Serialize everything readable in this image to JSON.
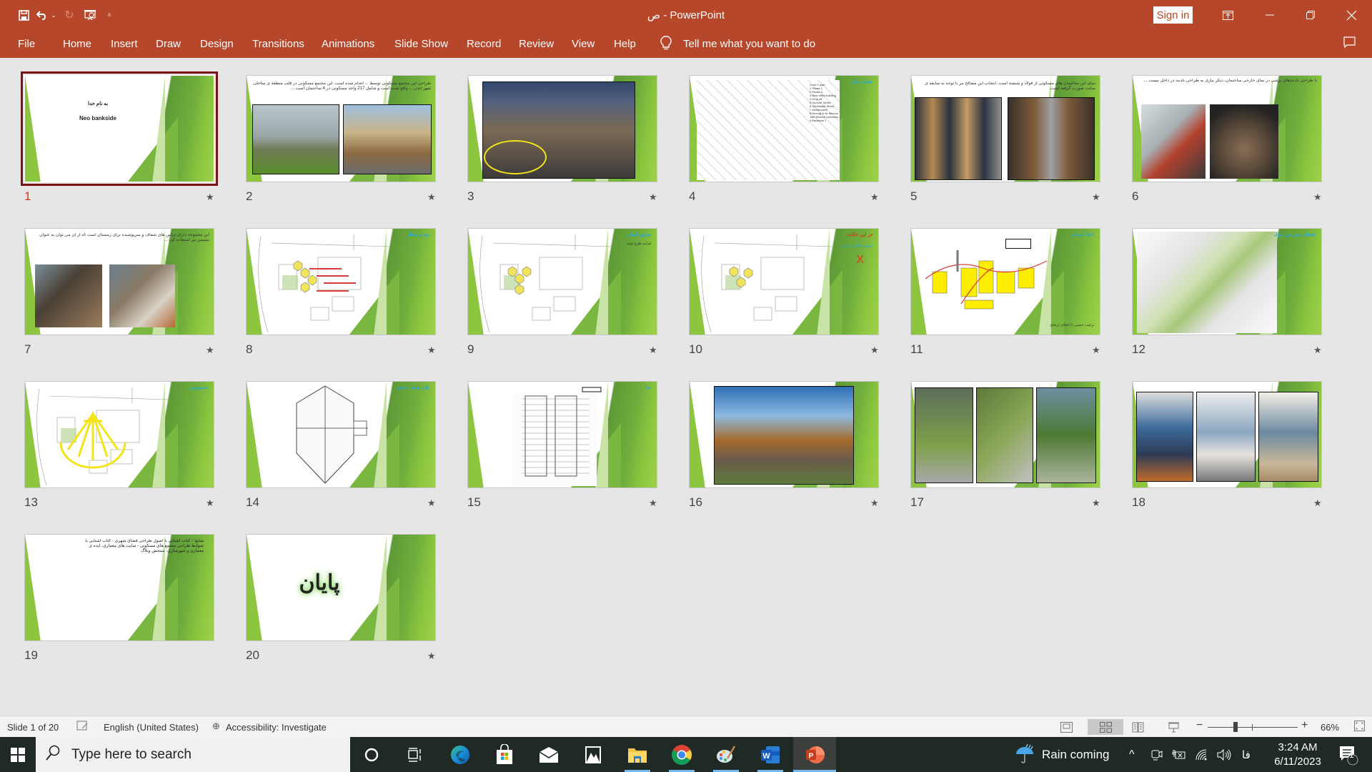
{
  "window": {
    "title": "ص  -  PowerPoint",
    "sign_in": "Sign in"
  },
  "quick_access": [
    "save-icon",
    "undo-icon",
    "undo-dropdown",
    "redo-icon",
    "present-from-start-icon",
    "customize-qat-icon"
  ],
  "menu": {
    "items": [
      "File",
      "Home",
      "Insert",
      "Draw",
      "Design",
      "Transitions",
      "Animations",
      "Slide Show",
      "Record",
      "Review",
      "View",
      "Help"
    ],
    "tell_me": "Tell me what you want to do"
  },
  "slides": [
    {
      "number": "1",
      "selected": true,
      "has_transition": true,
      "title": "به نام خدا",
      "subtitle": "Neo bankside"
    },
    {
      "number": "2",
      "selected": false,
      "has_transition": true,
      "text": "طراحی این مجتمع مسکونی توسط ... انجام شده است. این مجتمع مسکونی در قلب منطقه ی ساحلی شهر لندن ... واقع شده است و شامل 217 واحد مسکونی در 4 ساختمان است ..."
    },
    {
      "number": "3",
      "selected": false,
      "has_transition": true
    },
    {
      "number": "4",
      "selected": false,
      "has_transition": true,
      "label": "سایت پلان",
      "legend": [
        "Level 1 plan",
        "1 Phase 1",
        "2 Phase 2",
        "3 New office building",
        "4 Drop off",
        "5 Sumner Street",
        "6 Southwark Street",
        "7 Almshouses",
        "8 Herzog & de Meuron Tate Modern extension",
        "9 Bankside 1"
      ]
    },
    {
      "number": "5",
      "selected": false,
      "has_transition": true,
      "text": "نمای این ساختمان های مسکونی از فولاد و شیشه است. انتخاب این مصالح نیز با توجه به سابقه ی سایت صورت گرفته است."
    },
    {
      "number": "6",
      "selected": false,
      "has_transition": true,
      "text": "با طراحی بادبندهای برشی در نمای خارجی ساختمان، دیگر نیازی به طراحی بادبند در داخل نیست ..."
    },
    {
      "number": "7",
      "selected": false,
      "has_transition": true,
      "text": "این مجموعه دارای تراس های شفاف و سرپوشیده برای زمستان است که از آن می توان به عنوان نشیمن نیز استفاده کرد ..."
    },
    {
      "number": "8",
      "selected": false,
      "has_transition": true,
      "label": "دید و منظر"
    },
    {
      "number": "9",
      "selected": false,
      "has_transition": true,
      "label": "محور اصلی",
      "sublabel": "فرایند طرح اولیه"
    },
    {
      "number": "10",
      "selected": false,
      "has_transition": true,
      "label": "در این حالت",
      "sublabel": "ستون های مرکزی"
    },
    {
      "number": "11",
      "selected": false,
      "has_transition": true,
      "label": "خط آسمان",
      "sublabel": "ترکیب حجمی با اختلاف ارتفاع"
    },
    {
      "number": "12",
      "selected": false,
      "has_transition": true,
      "label": "فضای سبز بین بلوک"
    },
    {
      "number": "13",
      "selected": false,
      "has_transition": true,
      "label": "دسترسی"
    },
    {
      "number": "14",
      "selected": false,
      "has_transition": true,
      "label": "پلان طبقات تیپ"
    },
    {
      "number": "15",
      "selected": false,
      "has_transition": true,
      "label": "نما"
    },
    {
      "number": "16",
      "selected": false,
      "has_transition": true
    },
    {
      "number": "17",
      "selected": false,
      "has_transition": true
    },
    {
      "number": "18",
      "selected": false,
      "has_transition": true
    },
    {
      "number": "19",
      "selected": false,
      "has_transition": false,
      "text": "منابع: - کتاب آشنایی با اصول طراحی فضای شهری - کتاب آشنایی با ضوابط طراحی مجتمع های مسکونی - سایت های معماری، ایده ی معماری و شهرسازی، سنجش وبلاگ"
    },
    {
      "number": "20",
      "selected": false,
      "has_transition": true,
      "title": "پایان"
    }
  ],
  "status": {
    "slide_position": "Slide 1 of 20",
    "language": "English (United States)",
    "accessibility": "Accessibility: Investigate",
    "zoom_percent": "66%",
    "zoom_value": 66,
    "active_view": "slide-sorter"
  },
  "taskbar": {
    "search_placeholder": "Type here to search",
    "apps": [
      "cortana",
      "task-view",
      "edge",
      "microsoft-store",
      "mail",
      "photos",
      "file-explorer",
      "chrome",
      "paint",
      "word",
      "powerpoint"
    ],
    "weather": "Rain coming",
    "ime": "فا",
    "time": "3:24 AM",
    "date": "6/11/2023",
    "notifications": "1"
  }
}
